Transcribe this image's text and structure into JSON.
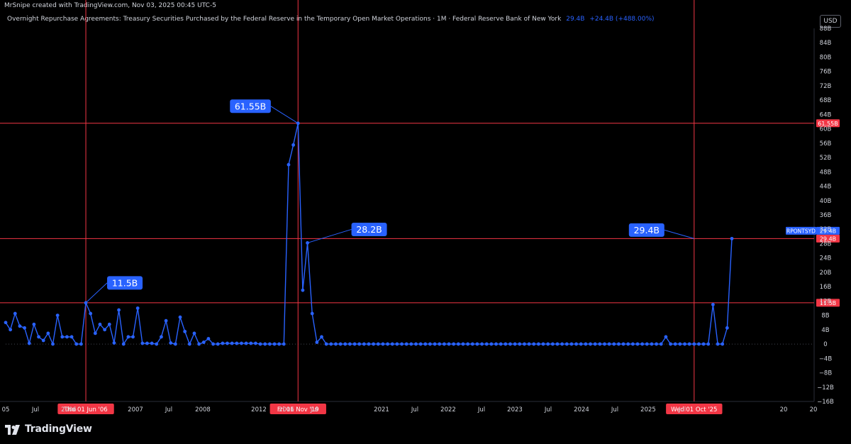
{
  "credit": "MrSnipe created with TradingView.com, Nov 03, 2025 00:45 UTC-5",
  "legend": {
    "title": "Overnight Repurchase Agreements: Treasury Securities Purchased by the Federal Reserve in the Temporary Open Market Operations · 1M · Federal Reserve Bank of New York",
    "value": "29.4B",
    "change": "+24.4B (+488.00%)"
  },
  "currency": "USD",
  "brand": "TradingView",
  "colors": {
    "background": "#000000",
    "series": "#2962ff",
    "marker_line": "#f23645",
    "axis_text": "#d1d4dc"
  },
  "chart_data": {
    "type": "line",
    "series": [
      {
        "name": "RPONTSYD",
        "values": [
          6,
          4,
          8.5,
          5,
          4.5,
          0.2,
          5.5,
          2,
          1,
          3,
          0,
          8,
          2,
          2,
          2,
          0,
          0,
          11.5,
          8.5,
          3,
          5.5,
          4,
          5.5,
          0.3,
          9.5,
          0,
          2,
          2,
          10,
          0.2,
          0.2,
          0.2,
          0,
          2,
          6.5,
          0.3,
          0,
          7.5,
          3.5,
          0,
          3,
          0,
          0.5,
          1.5,
          0,
          0,
          0.2,
          0.2,
          0.2,
          0.2,
          0.2,
          0.2,
          0.2,
          0.2,
          0,
          0,
          0,
          0,
          0,
          0,
          50,
          55.5,
          61.55,
          15,
          28.2,
          8.5,
          0.5,
          2,
          0,
          0,
          0,
          0,
          0,
          0,
          0,
          0,
          0,
          0,
          0,
          0,
          0,
          0,
          0,
          0,
          0,
          0,
          0,
          0,
          0,
          0,
          0,
          0,
          0,
          0,
          0,
          0,
          0,
          0,
          0,
          0,
          0,
          0,
          0,
          0,
          0,
          0,
          0,
          0,
          0,
          0,
          0,
          0,
          0,
          0,
          0,
          0,
          0,
          0,
          0,
          0,
          0,
          0,
          0,
          0,
          0,
          0,
          0,
          0,
          0,
          0,
          0,
          0,
          0,
          0,
          0,
          0,
          0,
          0,
          0,
          0,
          2,
          0,
          0,
          0,
          0,
          0,
          0,
          0,
          0,
          0,
          11,
          0,
          0,
          4.5,
          29.4
        ]
      }
    ],
    "value_unit": "B",
    "ylim": [
      -16,
      88
    ],
    "y_ticks": [
      "88B",
      "84B",
      "80B",
      "76B",
      "72B",
      "68B",
      "64B",
      "60B",
      "56B",
      "52B",
      "48B",
      "44B",
      "40B",
      "36B",
      "32B",
      "28B",
      "24B",
      "20B",
      "16B",
      "12B",
      "8B",
      "4B",
      "0",
      "−4B",
      "−8B",
      "−12B",
      "−16B"
    ],
    "x_ticks": [
      "05",
      "Jul",
      "2006",
      "2007",
      "Jul",
      "2008",
      "2012",
      "2016",
      "Jul",
      "2021",
      "Jul",
      "2022",
      "Jul",
      "2023",
      "Jul",
      "2024",
      "Jul",
      "2025",
      "Jul",
      "20"
    ],
    "callouts": [
      {
        "label": "11.5B",
        "value": 11.5,
        "point_index": 17
      },
      {
        "label": "61.55B",
        "value": 61.55,
        "point_index": 62
      },
      {
        "label": "28.2B",
        "value": 28.2,
        "point_index": 64
      },
      {
        "label": "29.4B",
        "value": 29.4,
        "point_index": 146
      }
    ],
    "horizontal_lines": [
      {
        "value": 61.55,
        "label": "61.55B"
      },
      {
        "value": 29.4,
        "label": "29.4B"
      },
      {
        "value": 11.5,
        "label": "11.5B"
      }
    ],
    "vertical_lines": [
      {
        "date_label": "Thu 01 Jun '06",
        "point_index": 17
      },
      {
        "date_label": "Fri 01 Nov '19",
        "point_index": 62
      },
      {
        "date_label": "Wed 01 Oct '25",
        "point_index": 146
      }
    ],
    "last_value_tag": {
      "name": "RPONTSYD",
      "value": "29.4B"
    },
    "grid": false
  }
}
